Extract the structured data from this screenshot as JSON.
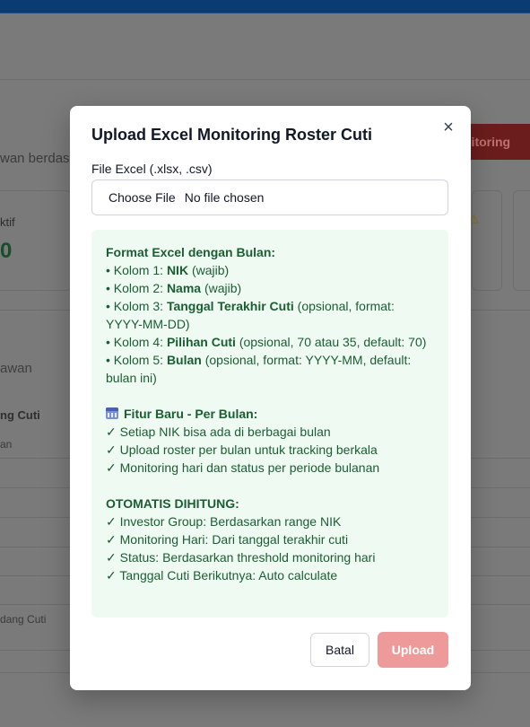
{
  "background": {
    "partial_labels": {
      "row_text": "wan berdas",
      "card_label": "ktif",
      "card_value": "0",
      "section_text": "awan",
      "col_header": "ng Cuti",
      "col_sub": "an",
      "bottom_label": "dang Cuti"
    },
    "red_button_label": "nitoring"
  },
  "modal": {
    "title": "Upload Excel Monitoring Roster Cuti",
    "close_label": "×",
    "file_label": "File Excel (.xlsx, .csv)",
    "file_button": "Choose File",
    "file_status": "No file chosen",
    "info": {
      "format_heading": "Format Excel dengan Bulan:",
      "col1": {
        "prefix": "• Kolom 1: ",
        "name": "NIK",
        "desc": " (wajib)"
      },
      "col2": {
        "prefix": "• Kolom 2: ",
        "name": "Nama",
        "desc": " (wajib)"
      },
      "col3": {
        "prefix": "• Kolom 3: ",
        "name": "Tanggal Terakhir Cuti",
        "desc": " (opsional, format: YYYY-MM-DD)"
      },
      "col4": {
        "prefix": "• Kolom 4: ",
        "name": "Pilihan Cuti",
        "desc": " (opsional, 70 atau 35, default: 70)"
      },
      "col5": {
        "prefix": "• Kolom 5: ",
        "name": "Bulan",
        "desc": " (opsional, format: YYYY-MM, default: bulan ini)"
      },
      "feature_icon": "calendar-icon",
      "feature_heading": "Fitur Baru - Per Bulan:",
      "feature_items": [
        "✓ Setiap NIK bisa ada di berbagai bulan",
        "✓ Upload roster per bulan untuk tracking berkala",
        "✓ Monitoring hari dan status per periode bulanan"
      ],
      "auto_heading": "OTOMATIS DIHITUNG:",
      "auto_items": [
        "✓ Investor Group: Berdasarkan range NIK",
        "✓ Monitoring Hari: Dari tanggal terakhir cuti",
        "✓ Status: Berdasarkan threshold monitoring hari",
        "✓ Tanggal Cuti Berikutnya: Auto calculate"
      ]
    },
    "cancel_label": "Batal",
    "upload_label": "Upload",
    "colors": {
      "upload_bg": "#ef9a9a",
      "info_bg": "#effaf2",
      "info_text": "#1b5e32"
    }
  }
}
